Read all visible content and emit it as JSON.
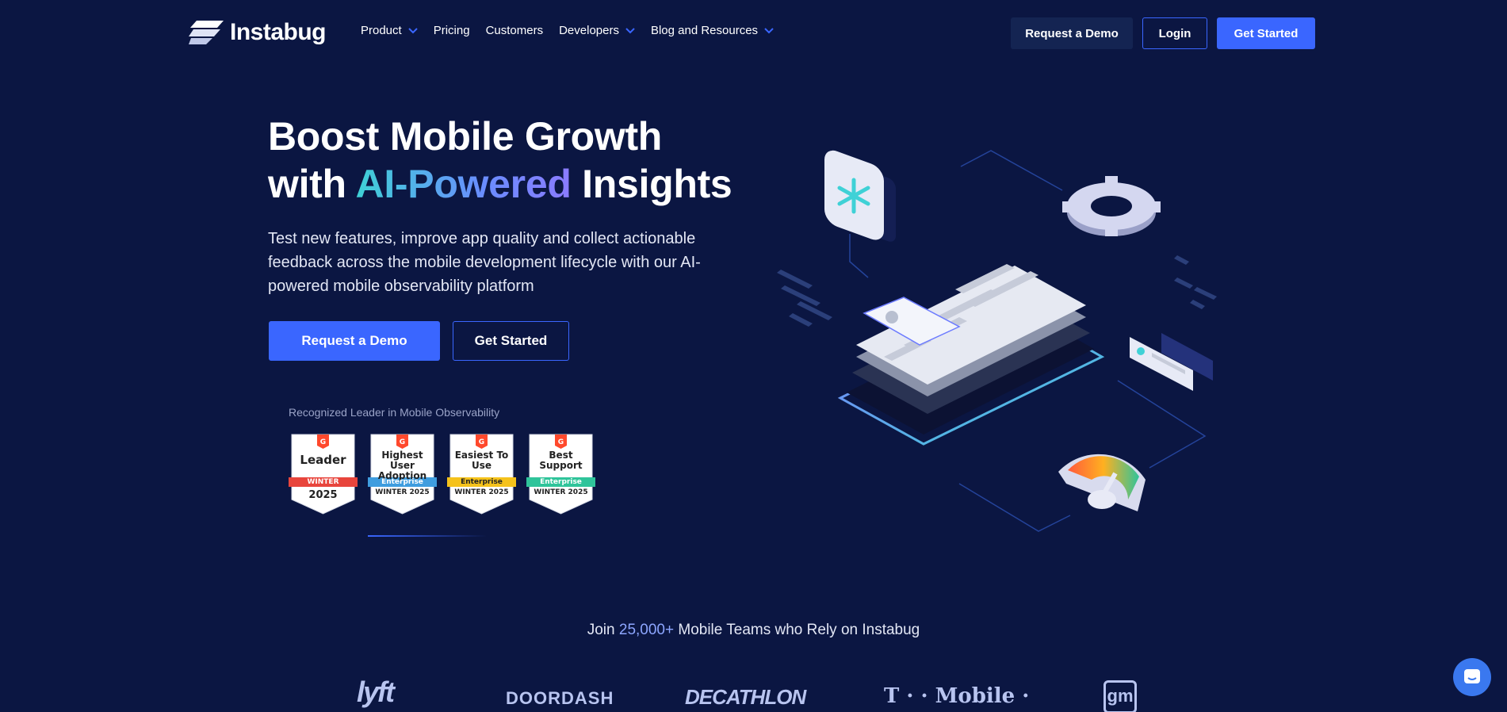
{
  "brand": {
    "name": "Instabug"
  },
  "nav": {
    "menu": [
      {
        "label": "Product",
        "dropdown": true
      },
      {
        "label": "Pricing",
        "dropdown": false
      },
      {
        "label": "Customers",
        "dropdown": false
      },
      {
        "label": "Developers",
        "dropdown": true
      },
      {
        "label": "Blog and Resources",
        "dropdown": true
      }
    ],
    "request_demo": "Request a Demo",
    "login": "Login",
    "get_started": "Get Started"
  },
  "hero": {
    "title_line1": "Boost Mobile Growth",
    "title_with": "with ",
    "title_highlight": "AI-Powered",
    "title_end": " Insights",
    "subtitle": "Test new features, improve app quality and collect actionable feedback across the mobile development lifecycle with our AI-powered mobile observability platform",
    "cta_demo": "Request a Demo",
    "cta_start": "Get Started"
  },
  "recognition": {
    "caption": "Recognized Leader in Mobile Observability",
    "badges": [
      {
        "title": "Leader",
        "band": "WINTER",
        "season": "2025",
        "band_color": "#e8453c"
      },
      {
        "title": "Highest User Adoption",
        "band": "Enterprise",
        "season": "WINTER 2025",
        "band_color": "#3f9ddf"
      },
      {
        "title": "Easiest To Use",
        "band": "Enterprise",
        "season": "WINTER 2025",
        "band_color": "#f5c21b"
      },
      {
        "title": "Best Support",
        "band": "Enterprise",
        "season": "WINTER 2025",
        "band_color": "#2fc49a"
      }
    ]
  },
  "join": {
    "prefix": "Join ",
    "count": "25,000+",
    "suffix": " Mobile Teams who Rely on Instabug"
  },
  "customer_logos": [
    "lyft",
    "DOORDASH",
    "DECATHLON",
    "T · · Mobile ·",
    "gm"
  ],
  "colors": {
    "background": "#0b1642",
    "accent": "#3a66ff",
    "chat": "#3a78ef"
  },
  "icons": [
    "instabug-logo-icon",
    "chevron-down-icon",
    "g2-badge-icon",
    "chat-bubble-icon"
  ]
}
